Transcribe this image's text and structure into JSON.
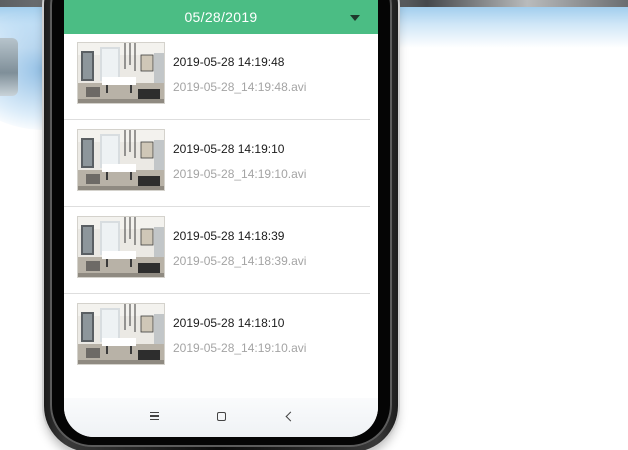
{
  "header": {
    "date": "05/28/2019",
    "dropdown_icon": "caret-down-icon"
  },
  "recordings": [
    {
      "title": "2019-05-28 14:19:48",
      "file": "2019-05-28_14:19:48.avi"
    },
    {
      "title": "2019-05-28 14:19:10",
      "file": "2019-05-28_14:19:10.avi"
    },
    {
      "title": "2019-05-28 14:18:39",
      "file": "2019-05-28_14:18:39.avi"
    },
    {
      "title": "2019-05-28 14:18:10",
      "file": "2019-05-28_14:19:10.avi"
    }
  ],
  "navbar": {
    "menu_icon": "menu-icon",
    "home_icon": "home-square-icon",
    "back_icon": "back-chevron-icon"
  },
  "colors": {
    "header_green": "#4bbd84",
    "title_text": "#1b1b1b",
    "file_text": "#a4a4a4"
  }
}
